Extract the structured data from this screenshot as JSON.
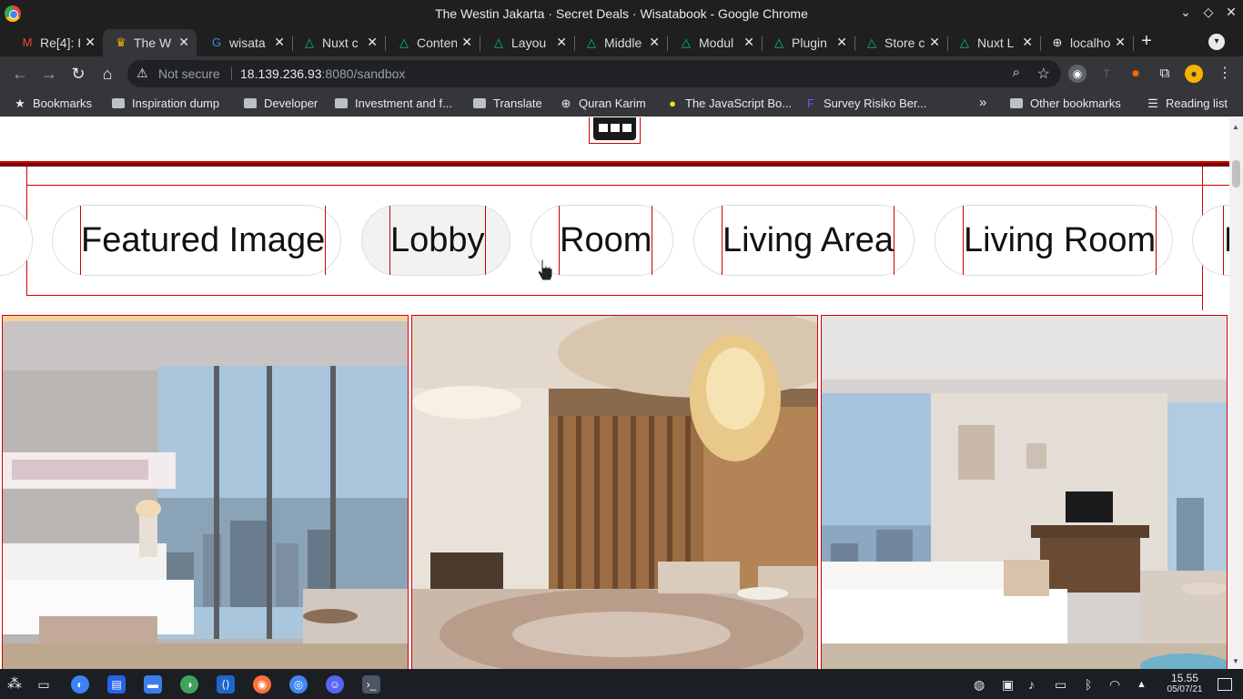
{
  "window": {
    "title": "The Westin Jakarta · Secret Deals · Wisatabook - Google Chrome",
    "controls": [
      "⌄",
      "◇",
      "✕"
    ]
  },
  "tabs": [
    {
      "label": "Re[4]: I",
      "icon": "M",
      "icon_name": "gmail-icon",
      "icon_color": "#ea4335",
      "active": false
    },
    {
      "label": "The W",
      "icon": "♛",
      "icon_name": "crown-icon",
      "icon_color": "#f4b400",
      "active": true
    },
    {
      "label": "wisata",
      "icon": "G",
      "icon_name": "google-icon",
      "icon_color": "#4285f4",
      "active": false
    },
    {
      "label": "Nuxt c",
      "icon": "△",
      "icon_name": "nuxt-icon",
      "icon_color": "#00c58e",
      "active": false
    },
    {
      "label": "Conten",
      "icon": "△",
      "icon_name": "nuxt-icon",
      "icon_color": "#00c58e",
      "active": false
    },
    {
      "label": "Layou",
      "icon": "△",
      "icon_name": "nuxt-icon",
      "icon_color": "#00c58e",
      "active": false
    },
    {
      "label": "Middle",
      "icon": "△",
      "icon_name": "nuxt-icon",
      "icon_color": "#00c58e",
      "active": false
    },
    {
      "label": "Modul",
      "icon": "△",
      "icon_name": "nuxt-icon",
      "icon_color": "#00c58e",
      "active": false
    },
    {
      "label": "Plugin",
      "icon": "△",
      "icon_name": "nuxt-icon",
      "icon_color": "#00c58e",
      "active": false
    },
    {
      "label": "Store c",
      "icon": "△",
      "icon_name": "nuxt-icon",
      "icon_color": "#00c58e",
      "active": false
    },
    {
      "label": "Nuxt L",
      "icon": "△",
      "icon_name": "nuxt-icon",
      "icon_color": "#00c58e",
      "active": false
    },
    {
      "label": "localho",
      "icon": "⊕",
      "icon_name": "globe-icon",
      "icon_color": "#e8eaed",
      "active": false
    }
  ],
  "toolbar": {
    "not_secure": "Not secure",
    "url_host": "18.139.236.93",
    "url_rest": ":8080/sandbox"
  },
  "bookmarks": [
    {
      "label": "Bookmarks",
      "icon": "★",
      "icon_name": "star-icon"
    },
    {
      "label": "Inspiration dump",
      "icon": "folder",
      "icon_name": "folder-icon"
    },
    {
      "label": "Developer",
      "icon": "folder",
      "icon_name": "folder-icon"
    },
    {
      "label": "Investment and f...",
      "icon": "folder",
      "icon_name": "folder-icon"
    },
    {
      "label": "Translate",
      "icon": "folder",
      "icon_name": "folder-icon"
    },
    {
      "label": "Quran Karim",
      "icon": "⊕",
      "icon_name": "globe-icon"
    },
    {
      "label": "The JavaScript Bo...",
      "icon": "●",
      "icon_name": "js-book-icon"
    },
    {
      "label": "Survey Risiko Ber...",
      "icon": "F",
      "icon_name": "form-icon"
    }
  ],
  "bookmarks_overflow": "»",
  "bookmarks_right": [
    {
      "label": "Other bookmarks",
      "icon": "folder",
      "icon_name": "folder-icon"
    },
    {
      "label": "Reading list",
      "icon": "☰",
      "icon_name": "reading-list-icon"
    }
  ],
  "page": {
    "chips": [
      {
        "label": "Featured Image",
        "selected": false
      },
      {
        "label": "Lobby",
        "selected": true
      },
      {
        "label": "Room",
        "selected": false
      },
      {
        "label": "Living Area",
        "selected": false
      },
      {
        "label": "Living Room",
        "selected": false
      }
    ],
    "partial_chip_right": "R",
    "gallery": [
      {
        "name": "bedroom-photo",
        "alt": "room"
      },
      {
        "name": "lobby-photo",
        "alt": "lobby"
      },
      {
        "name": "room-photo",
        "alt": "room"
      }
    ]
  },
  "taskbar": {
    "time": "15.55",
    "date": "05/07/21"
  },
  "colors": {
    "outline": "#d10000",
    "dark_red": "#7a0000",
    "chrome_dark": "#1f1f1f",
    "chrome_toolbar": "#35363a"
  }
}
